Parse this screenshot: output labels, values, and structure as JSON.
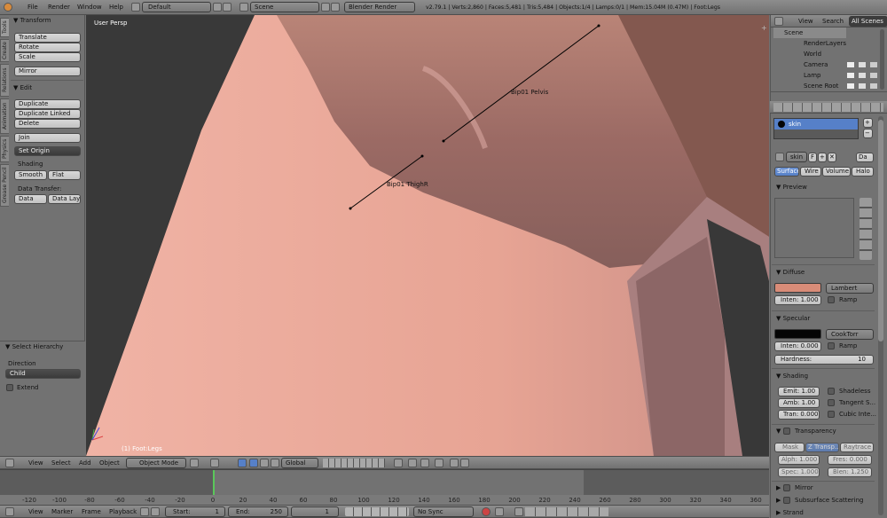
{
  "top_menu": {
    "file": "File",
    "render": "Render",
    "window": "Window",
    "help": "Help",
    "layout": "Default",
    "scene": "Scene",
    "engine": "Blender Render",
    "stats": "v2.79.1 | Verts:2,860 | Faces:5,481 | Tris:5,484 | Objects:1/4 | Lamps:0/1 | Mem:15.04M (0.47M) | Foot:Legs"
  },
  "side_tabs": [
    "Tools",
    "Create",
    "Relations",
    "Animation",
    "Physics",
    "Grease Pencil"
  ],
  "tool_shelf": {
    "transform_title": "Transform",
    "translate": "Translate",
    "rotate": "Rotate",
    "scale": "Scale",
    "mirror": "Mirror",
    "edit_title": "Edit",
    "duplicate": "Duplicate",
    "duplicate_linked": "Duplicate Linked",
    "delete": "Delete",
    "join": "Join",
    "set_origin": "Set Origin",
    "shading_title": "Shading",
    "smooth": "Smooth",
    "flat": "Flat",
    "data_transfer_title": "Data Transfer:",
    "data": "Data",
    "data_layo": "Data Layo",
    "select_hierarchy_title": "Select Hierarchy",
    "direction_label": "Direction",
    "direction_value": "Child",
    "extend": "Extend"
  },
  "viewport": {
    "view_name": "User Persp",
    "object_label": "(1) Foot:Legs",
    "bone_pelvis": "Bip01 Pelvis",
    "bone_thigh": "Bip01 ThighR"
  },
  "view3d_header": {
    "view": "View",
    "select": "Select",
    "add": "Add",
    "object": "Object",
    "mode": "Object Mode",
    "orientation": "Global"
  },
  "timeline": {
    "ticks": [
      "-120",
      "-100",
      "-80",
      "-60",
      "-40",
      "-20",
      "0",
      "20",
      "40",
      "60",
      "80",
      "100",
      "120",
      "140",
      "160",
      "180",
      "200",
      "220",
      "240",
      "260",
      "280",
      "300",
      "320",
      "340",
      "360"
    ],
    "view": "View",
    "marker": "Marker",
    "frame": "Frame",
    "playback": "Playback",
    "start": "Start:",
    "start_val": "1",
    "end": "End:",
    "end_val": "250",
    "current": "1",
    "sync": "No Sync"
  },
  "outliner": {
    "view": "View",
    "search": "Search",
    "all_scenes": "All Scenes",
    "items": [
      "Scene",
      "RenderLayers",
      "World",
      "Camera",
      "Lamp",
      "Scene Root"
    ]
  },
  "properties": {
    "material_name": "skin",
    "material_field": "skin",
    "f_label": "F",
    "da": "Da",
    "tabs": [
      "Surface",
      "Wire",
      "Volume",
      "Halo"
    ],
    "preview": "Preview",
    "diffuse": "Diffuse",
    "diffuse_shader": "Lambert",
    "diffuse_inten": "Inten: 1.000",
    "ramp": "Ramp",
    "specular": "Specular",
    "spec_shader": "CookTorr",
    "spec_inten": "Inten: 0.000",
    "hardness_label": "Hardness:",
    "hardness_val": "10",
    "shading": "Shading",
    "emit": "Emit:  1.00",
    "amb": "Amb:  1.00",
    "tran": "Tran:  0.000",
    "shadeless": "Shadeless",
    "tangent": "Tangent S...",
    "cubic": "Cubic Inte...",
    "transparency": "Transparency",
    "mask": "Mask",
    "z_transp": "Z Transp...",
    "raytrace": "Raytrace",
    "alph": "Alph: 1.000",
    "fres": "Fres: 0.000",
    "spec": "Spec: 1.000",
    "blen": "Blen: 1.250",
    "mirror": "Mirror",
    "sss": "Subsurface Scattering",
    "strand": "Strand"
  },
  "colors": {
    "diffuse": "#d98c78",
    "specular": "#050505",
    "skin": "#e8a898",
    "viewport_bg": "#393939"
  }
}
